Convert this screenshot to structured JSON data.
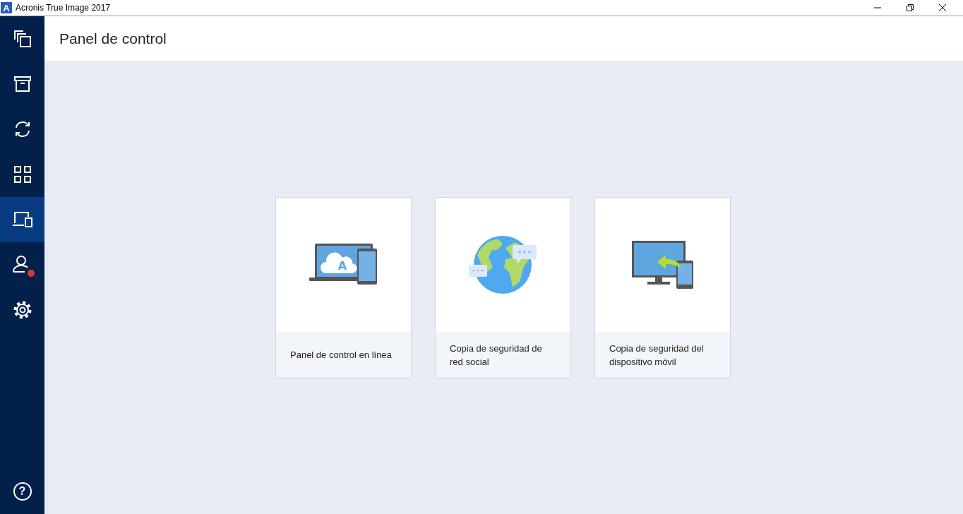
{
  "window": {
    "logo_letter": "A",
    "title": "Acronis True Image 2017"
  },
  "sidebar": {
    "items": [
      {
        "kind": "copies",
        "selected": false,
        "alert": false
      },
      {
        "kind": "archive",
        "selected": false,
        "alert": false
      },
      {
        "kind": "sync",
        "selected": false,
        "alert": false
      },
      {
        "kind": "tools",
        "selected": false,
        "alert": false
      },
      {
        "kind": "dashboard",
        "selected": true,
        "alert": false
      },
      {
        "kind": "account",
        "selected": false,
        "alert": true
      },
      {
        "kind": "settings",
        "selected": false,
        "alert": false
      }
    ],
    "help_symbol": "?"
  },
  "header": {
    "title": "Panel de control"
  },
  "cards": [
    {
      "kind": "online",
      "label": "Panel de control en línea",
      "cloud_letter": "A"
    },
    {
      "kind": "social",
      "label": "Copia de seguridad de red social"
    },
    {
      "kind": "mobile",
      "label": "Copia de seguridad del dispositivo móvil"
    }
  ]
}
